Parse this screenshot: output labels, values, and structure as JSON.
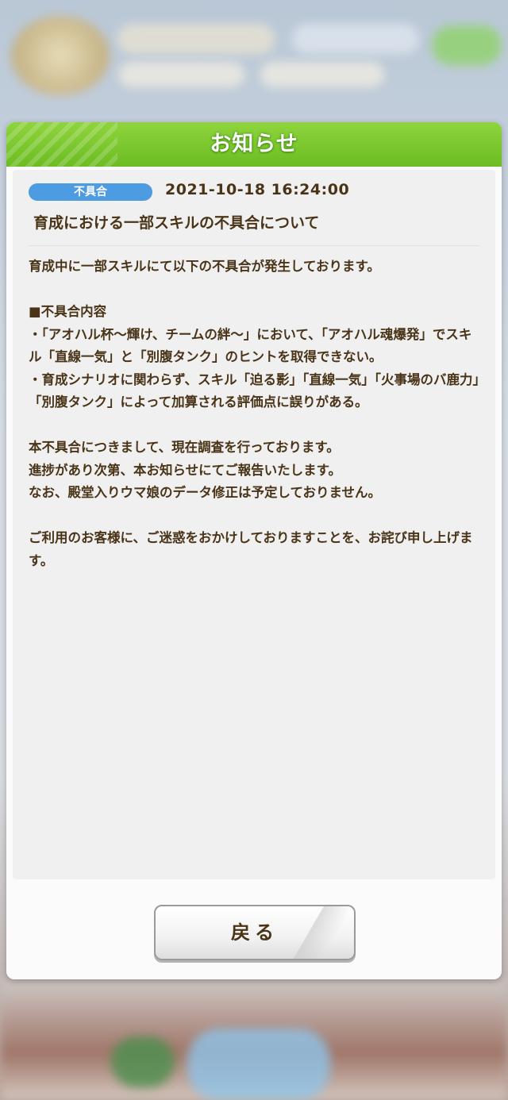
{
  "dialog": {
    "title": "お知らせ",
    "tag": "不具合",
    "timestamp": "2021-10-18 16:24:00",
    "news_title": "育成における一部スキルの不具合について",
    "body": [
      "育成中に一部スキルにて以下の不具合が発生しております。",
      "",
      "■不具合内容",
      "・「アオハル杯～輝け、チームの絆～」において、「アオハル魂爆発」でスキル「直線一気」と「別腹タンク」のヒントを取得できない。",
      "・育成シナリオに関わらず、スキル「迫る影」「直線一気」「火事場のバ鹿力」「別腹タンク」によって加算される評価点に誤りがある。",
      "",
      "本不具合につきまして、現在調査を行っております。",
      "進捗があり次第、本お知らせにてご報告いたします。",
      "なお、殿堂入りウマ娘のデータ修正は予定しておりません。",
      "",
      "ご利用のお客様に、ご迷惑をおかけしておりますことを、お詫び申し上げます。"
    ],
    "back_label": "戻る"
  },
  "colors": {
    "header_green": "#7cc72f",
    "tag_blue": "#4d9be0",
    "text_brown": "#4a3418"
  }
}
